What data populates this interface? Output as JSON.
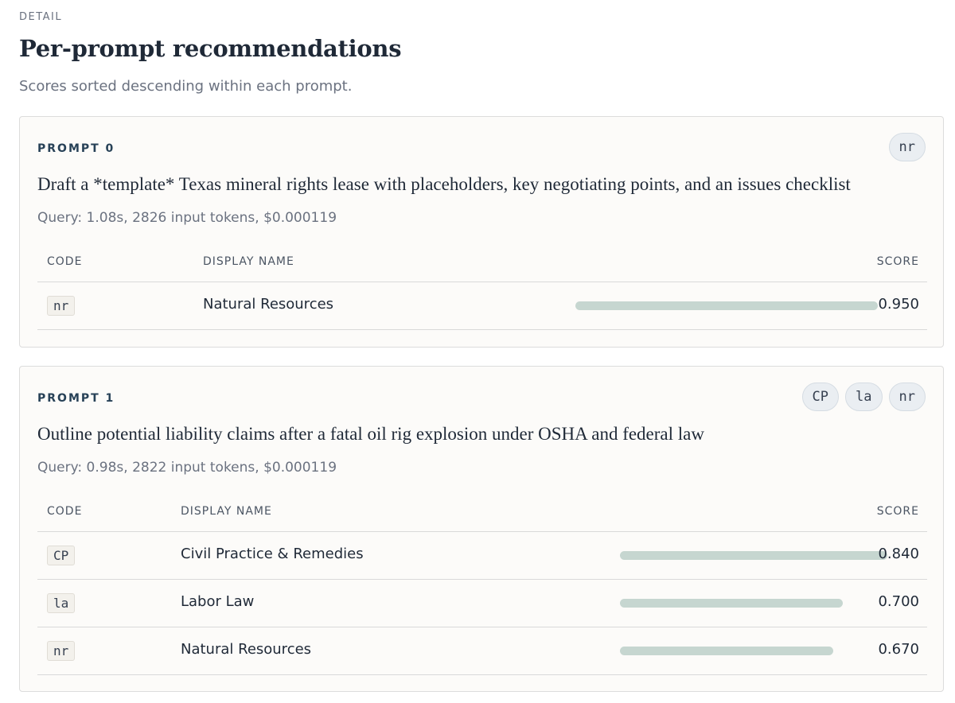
{
  "header": {
    "eyebrow": "DETAIL",
    "title": "Per-prompt recommendations",
    "subtitle": "Scores sorted descending within each prompt."
  },
  "columns": {
    "code": "CODE",
    "display_name": "DISPLAY NAME",
    "score": "SCORE"
  },
  "prompts": [
    {
      "label": "PROMPT 0",
      "chips": [
        "nr"
      ],
      "text": "Draft a *template* Texas mineral rights lease with placeholders, key negotiating points, and an issues checklist",
      "query": "Query: 1.08s, 2826 input tokens, $0.000119",
      "rows": [
        {
          "code": "nr",
          "name": "Natural Resources",
          "score": "0.950",
          "value": 0.95
        }
      ]
    },
    {
      "label": "PROMPT 1",
      "chips": [
        "CP",
        "la",
        "nr"
      ],
      "text": "Outline potential liability claims after a fatal oil rig explosion under OSHA and federal law",
      "query": "Query: 0.98s, 2822 input tokens, $0.000119",
      "rows": [
        {
          "code": "CP",
          "name": "Civil Practice & Remedies",
          "score": "0.840",
          "value": 0.84
        },
        {
          "code": "la",
          "name": "Labor Law",
          "score": "0.700",
          "value": 0.7
        },
        {
          "code": "nr",
          "name": "Natural Resources",
          "score": "0.670",
          "value": 0.67
        }
      ]
    }
  ]
}
